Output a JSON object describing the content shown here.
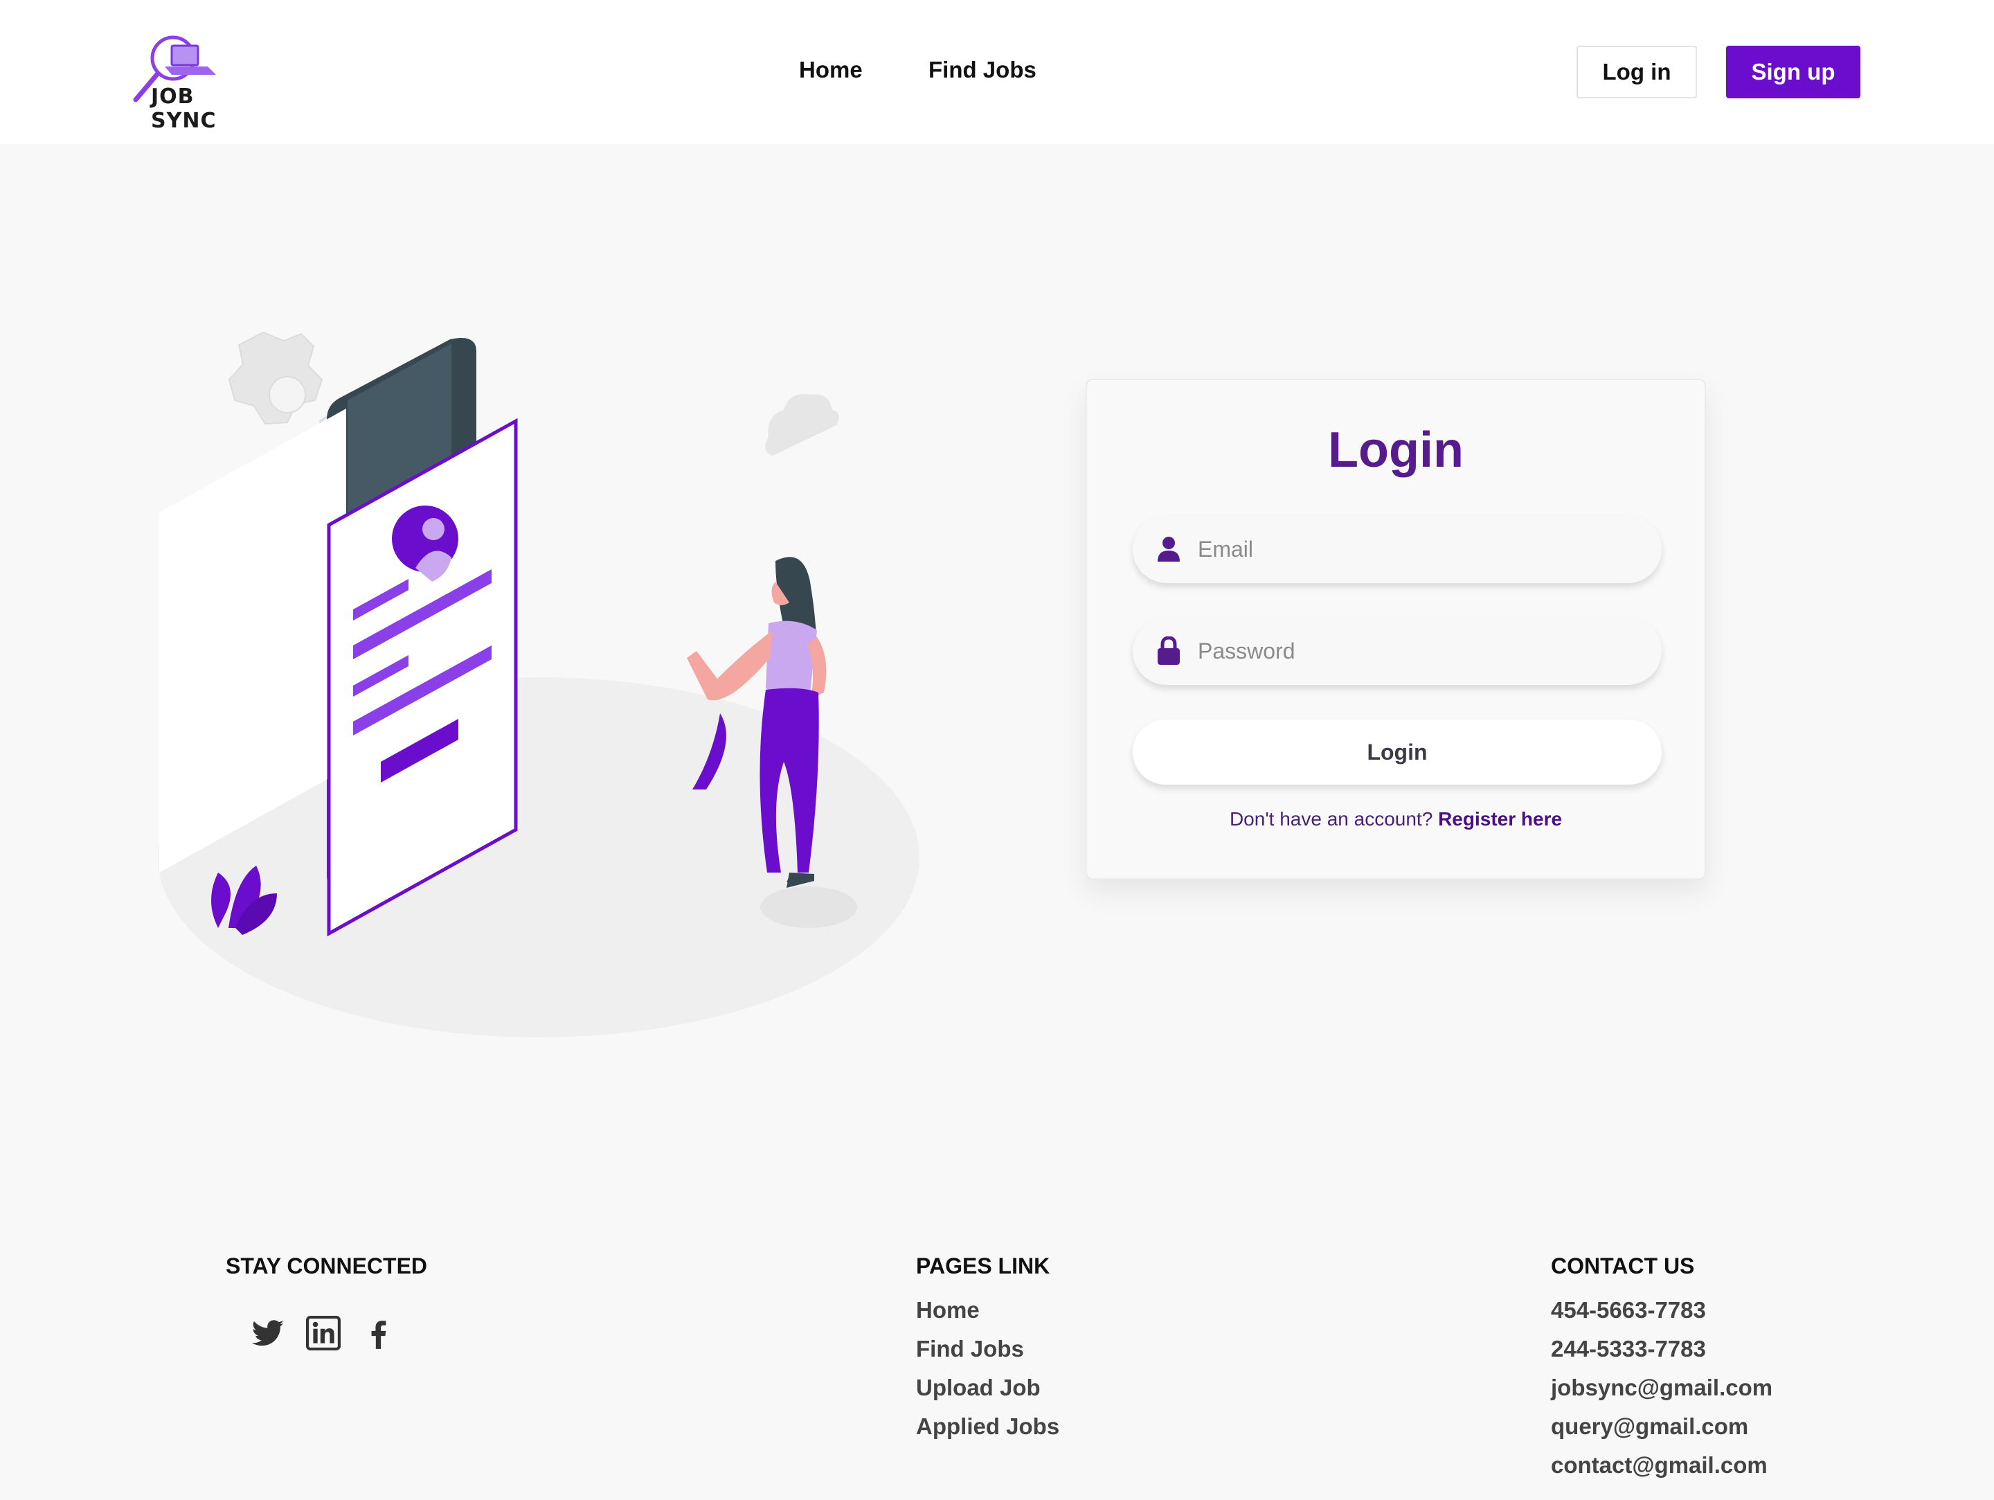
{
  "header": {
    "logo_text": "JOB SYNC",
    "nav": [
      {
        "label": "Home"
      },
      {
        "label": "Find Jobs"
      }
    ],
    "login_label": "Log in",
    "signup_label": "Sign up"
  },
  "login_card": {
    "title": "Login",
    "email_placeholder": "Email",
    "password_placeholder": "Password",
    "submit_label": "Login",
    "register_prompt": "Don't have an account?",
    "register_link": "Register here"
  },
  "footer": {
    "stay_connected": {
      "heading": "STAY CONNECTED",
      "icons": [
        "twitter-icon",
        "linkedin-icon",
        "facebook-icon"
      ]
    },
    "pages_link": {
      "heading": "PAGES LINK",
      "items": [
        "Home",
        "Find Jobs",
        "Upload Job",
        "Applied Jobs"
      ]
    },
    "contact_us": {
      "heading": "CONTACT US",
      "items": [
        "454-5663-7783",
        "244-5333-7783",
        "jobsync@gmail.com",
        "query@gmail.com",
        "contact@gmail.com"
      ]
    }
  },
  "colors": {
    "brand_purple": "#6a0dcc",
    "title_purple": "#561b8c",
    "background": "#f8f8f8"
  }
}
